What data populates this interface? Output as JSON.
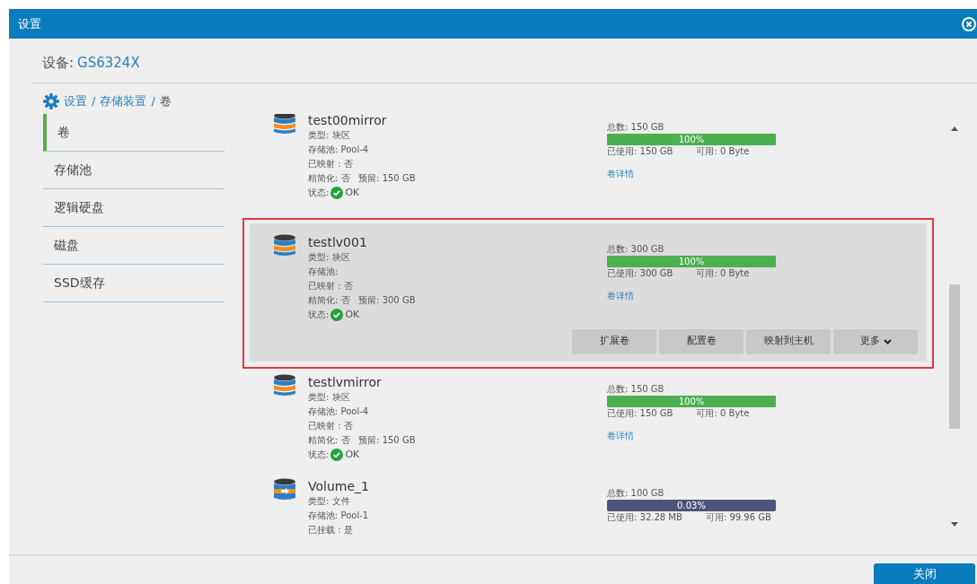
{
  "window": {
    "title": "设置"
  },
  "device": {
    "label": "设备:",
    "value": "GS6324X"
  },
  "breadcrumb": [
    "设置",
    "/",
    "存储装置",
    "/",
    "卷"
  ],
  "sidebar": {
    "items": [
      {
        "label": "卷",
        "selected": true
      },
      {
        "label": "存储池",
        "selected": false
      },
      {
        "label": "逻辑硬盘",
        "selected": false
      },
      {
        "label": "磁盘",
        "selected": false
      },
      {
        "label": "SSD缓存",
        "selected": false
      }
    ]
  },
  "volumes": [
    {
      "kind": "block",
      "name": "test00mirror",
      "selected": false,
      "details": [
        "类型: 块区",
        "存储池: Pool-4",
        "已映射 : 否",
        "精简化: 否   预留: 150 GB"
      ],
      "status": {
        "label": "状态:",
        "value": "OK"
      },
      "total": "总数: 150 GB",
      "percent": "100%",
      "level": 1,
      "used": "已使用: 150 GB",
      "free": "可用: 0 Byte",
      "link": "卷详情"
    },
    {
      "kind": "block",
      "name": "testlv001",
      "selected": true,
      "details": [
        "类型: 块区",
        "存储池:",
        "已映射 : 否",
        "精简化: 否   预留: 300 GB"
      ],
      "status": {
        "label": "状态:",
        "value": "OK"
      },
      "total": "总数: 300 GB",
      "percent": "100%",
      "level": 1,
      "used": "已使用: 300 GB",
      "free": "可用: 0 Byte",
      "link": "卷详情",
      "actions": [
        "扩展卷",
        "配置卷",
        "映射到主机",
        "更多"
      ]
    },
    {
      "kind": "block",
      "name": "testlvmirror",
      "selected": false,
      "details": [
        "类型: 块区",
        "存储池: Pool-4",
        "已映射 : 否",
        "精简化: 否   预留: 150 GB"
      ],
      "status": {
        "label": "状态:",
        "value": "OK"
      },
      "total": "总数: 150 GB",
      "percent": "100%",
      "level": 1,
      "used": "已使用: 150 GB",
      "free": "可用: 0 Byte",
      "link": "卷详情"
    },
    {
      "kind": "file",
      "name": "Volume_1",
      "selected": false,
      "details": [
        "类型: 文件",
        "存储池: Pool-1",
        "已挂载 : 是"
      ],
      "total": "总数: 100 GB",
      "percent": "0.03%",
      "level": 0.0003,
      "used": "已使用: 32.28 MB",
      "free": "可用: 99.96 GB"
    }
  ],
  "footer": {
    "close_button": "关闭"
  }
}
